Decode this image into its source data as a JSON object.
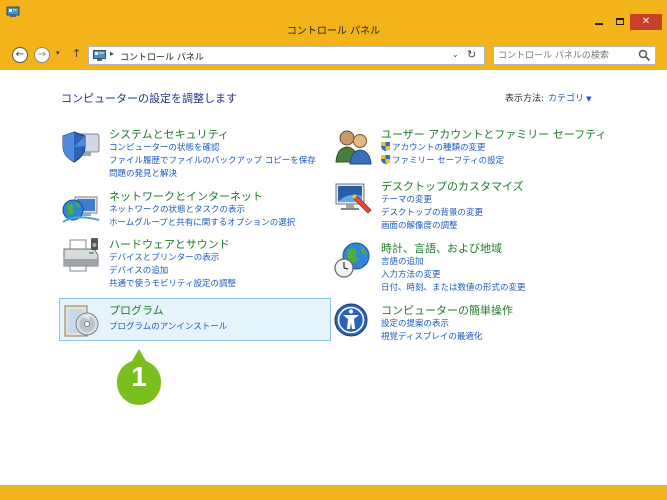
{
  "window": {
    "title": "コントロール パネル",
    "controls": {
      "minimize": "−",
      "maximize": "□",
      "close": "✕"
    }
  },
  "nav": {
    "back": "←",
    "forward": "→",
    "recent": "▾",
    "up": "↑",
    "address_separator": "▸",
    "address": "コントロール パネル",
    "address_dropdown": "⌄",
    "refresh": "↻",
    "search_placeholder": "コントロール パネルの検索"
  },
  "page": {
    "title": "コンピューターの設定を調整します",
    "view_by_label": "表示方法:",
    "view_by_value": "カテゴリ",
    "view_by_caret": "▼"
  },
  "categories": [
    {
      "title": "システムとセキュリティ",
      "icon": "shield-icon",
      "links": [
        "コンピューターの状態を確認",
        "ファイル履歴でファイルのバックアップ コピーを保存",
        "問題の発見と解決"
      ]
    },
    {
      "title": "ネットワークとインターネット",
      "icon": "network-globe-icon",
      "links": [
        "ネットワークの状態とタスクの表示",
        "ホームグループと共有に関するオプションの選択"
      ]
    },
    {
      "title": "ハードウェアとサウンド",
      "icon": "printer-icon",
      "links": [
        "デバイスとプリンターの表示",
        "デバイスの追加",
        "共通で使うモビリティ設定の調整"
      ]
    },
    {
      "title": "プログラム",
      "icon": "programs-icon",
      "links": [
        "プログラムのアンインストール"
      ]
    },
    {
      "title": "ユーザー アカウントとファミリー セーフティ",
      "icon": "users-icon",
      "links": [
        "アカウントの種類の変更",
        "ファミリー セーフティの設定"
      ]
    },
    {
      "title": "デスクトップのカスタマイズ",
      "icon": "desktop-personalize-icon",
      "links": [
        "テーマの変更",
        "デスクトップの背景の変更",
        "画面の解像度の調整"
      ]
    },
    {
      "title": "時計、言語、および地域",
      "icon": "clock-globe-icon",
      "links": [
        "言語の追加",
        "入力方法の変更",
        "日付、時刻、または数値の形式の変更"
      ]
    },
    {
      "title": "コンピューターの簡単操作",
      "icon": "ease-of-access-icon",
      "links": [
        "設定の提案の表示",
        "視覚ディスプレイの最適化"
      ]
    }
  ],
  "annotation": {
    "step": "1",
    "color": "#7bbf1e"
  },
  "colors": {
    "frame": "#f2b41a",
    "category_title": "#1e7a2a",
    "link": "#1b58c2",
    "page_title": "#1e3287",
    "highlight_bg": "#e5f3fb",
    "highlight_border": "#8dc7e8"
  }
}
